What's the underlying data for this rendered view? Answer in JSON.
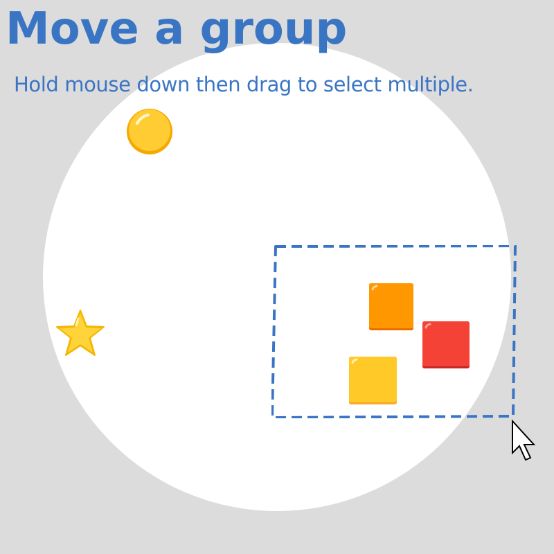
{
  "header": {
    "title": "Move a group",
    "subtitle": "Hold mouse down then drag to select multiple."
  },
  "colors": {
    "background": "#dcdcdc",
    "play_area": "#ffffff",
    "accent_text": "#3a75c4",
    "selection_border": "#3a75c4",
    "circle": "#ffcc33",
    "star": "#ffd43b",
    "square_orange": "#ff9800",
    "square_red": "#f44336",
    "square_yellow": "#ffca28"
  },
  "pieces": [
    {
      "name": "circle",
      "icon": "yellow-circle-icon",
      "selected": false
    },
    {
      "name": "star",
      "icon": "star-icon",
      "selected": false
    },
    {
      "name": "orange-square",
      "icon": "orange-square-icon",
      "selected": true
    },
    {
      "name": "red-square",
      "icon": "red-square-icon",
      "selected": true
    },
    {
      "name": "yellow-square",
      "icon": "yellow-square-icon",
      "selected": true
    }
  ],
  "selection": {
    "active": true,
    "style": "dashed"
  },
  "cursor": {
    "icon": "arrow-pointer-icon"
  }
}
